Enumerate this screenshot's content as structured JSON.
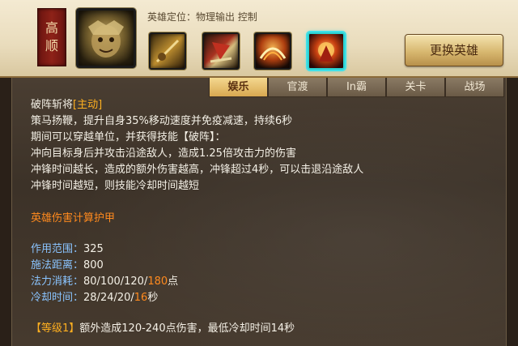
{
  "header": {
    "name_chars": [
      "高",
      "顺"
    ],
    "role": "英雄定位：物理输出 控制",
    "change_button": "更换英雄",
    "skills": [
      "skill-1-icon",
      "skill-2-icon",
      "skill-3-icon",
      "skill-4-icon"
    ],
    "selected_skill_color": "#40e0e8"
  },
  "tabs": [
    {
      "label": "娱乐",
      "active": true
    },
    {
      "label": "官渡",
      "active": false
    },
    {
      "label": "In霸",
      "active": false
    },
    {
      "label": "关卡",
      "active": false
    },
    {
      "label": "战场",
      "active": false
    }
  ],
  "skill": {
    "name": "破阵斩将",
    "type": "[主动]",
    "desc": [
      "策马扬鞭，提升自身35%移动速度并免疫减速，持续6秒",
      "期间可以穿越单位，并获得技能【破阵】：",
      "冲向目标身后并攻击沿途敌人，造成1.25倍攻击力的伤害",
      "冲锋时间越长，造成的额外伤害越高，冲锋超过4秒，可以击退沿途敌人",
      "冲锋时间越短，则技能冷却时间越短"
    ],
    "armor_note": "英雄伤害计算护甲",
    "stats": {
      "range_label": "作用范围：",
      "range_value": "325",
      "cast_label": "施法距离：",
      "cast_value": "800",
      "mana_label": "法力消耗：",
      "mana_value": "80/100/120/",
      "mana_max": "180",
      "mana_unit": "点",
      "cd_label": "冷却时间：",
      "cd_value": "28/24/20/",
      "cd_max": "16",
      "cd_unit": "秒"
    },
    "level": {
      "tag": "【等级1】",
      "text": "额外造成120-240点伤害，最低冷却时间14秒"
    }
  },
  "colors": {
    "accent_orange": "#ff8a1e",
    "stat_blue": "#8ac4ff",
    "tab_active": "#d8a850"
  }
}
